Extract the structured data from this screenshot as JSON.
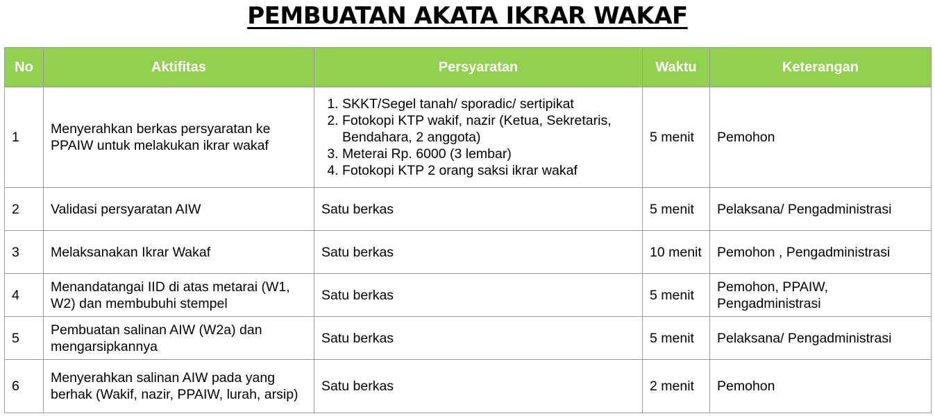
{
  "title": "PEMBUATAN AKATA IKRAR WAKAF",
  "table": {
    "headers": [
      "No",
      "Aktifitas",
      "Persyaratan",
      "Waktu",
      "Keterangan"
    ],
    "rows": [
      {
        "no": "1",
        "aktifitas": "Menyerahkan berkas persyaratan ke PPAIW untuk melakukan ikrar wakaf",
        "persyaratan": [
          "SKKT/Segel tanah/ sporadic/ sertipikat",
          "Fotokopi KTP wakif, nazir (Ketua, Sekretaris, Bendahara, 2 anggota)",
          "Meterai Rp. 6000 (3 lembar)",
          "Fotokopi KTP 2 orang saksi ikrar wakaf"
        ],
        "waktu": "5 menit",
        "keterangan": "Pemohon"
      },
      {
        "no": "2",
        "aktifitas": "Validasi persyaratan AIW",
        "persyaratan": "Satu berkas",
        "waktu": "5 menit",
        "keterangan": "Pelaksana/ Pengadministrasi"
      },
      {
        "no": "3",
        "aktifitas": "Melaksanakan Ikrar Wakaf",
        "persyaratan": "Satu berkas",
        "waktu": "10 menit",
        "keterangan": "Pemohon , Pengadministrasi"
      },
      {
        "no": "4",
        "aktifitas": "Menandatangai IID di atas metarai (W1, W2) dan membubuhi stempel",
        "persyaratan": "Satu berkas",
        "waktu": "5 menit",
        "keterangan": "Pemohon,  PPAIW, Pengadministrasi"
      },
      {
        "no": "5",
        "aktifitas": "Pembuatan salinan AIW (W2a) dan mengarsipkannya",
        "persyaratan": "Satu berkas",
        "waktu": "5 menit",
        "keterangan": "Pelaksana/ Pengadministrasi"
      },
      {
        "no": "6",
        "aktifitas": "Menyerahkan salinan AIW pada yang berhak (Wakif, nazir, PPAIW, lurah, arsip)",
        "persyaratan": "Satu berkas",
        "waktu": "2 menit",
        "keterangan": "Pemohon"
      }
    ]
  },
  "colors": {
    "header_bg": "#92d050",
    "header_text": "#ffffff",
    "border": "#9a9a9a"
  }
}
